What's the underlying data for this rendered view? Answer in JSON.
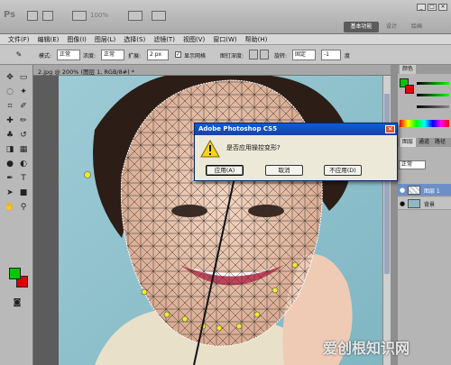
{
  "app": {
    "logo": "Ps",
    "zoom": "100%",
    "workspaces": {
      "active": "基本功能",
      "others": [
        "设计",
        "绘画"
      ]
    }
  },
  "menu": [
    "文件(F)",
    "编辑(E)",
    "图像(I)",
    "图层(L)",
    "选择(S)",
    "滤镜(T)",
    "视图(V)",
    "窗口(W)",
    "帮助(H)"
  ],
  "options": {
    "mode_label": "模式:",
    "mode_value": "正常",
    "density_label": "浓度:",
    "density_value": "正常",
    "expand_label": "扩展:",
    "expand_value": "2 px",
    "show_mesh_label": "显示网格",
    "pin_depth_label": "图钉深度:",
    "rotate_label": "旋转:",
    "rotate_value": "固定",
    "angle_value": "-1",
    "degree_label": "度"
  },
  "document": {
    "tab_label": "2.jpg @ 200% (图层 1, RGB/8#) *"
  },
  "colors": {
    "foreground": "#00c800",
    "background": "#e00000",
    "accent": "#0a5ed8"
  },
  "panels": {
    "color_tab": "颜色",
    "layers_tabs": [
      "图层",
      "通道",
      "路径"
    ],
    "blend_mode": "正常",
    "layers": [
      {
        "name": "图层 1",
        "selected": true
      },
      {
        "name": "背景",
        "selected": false
      }
    ]
  },
  "dialog": {
    "title": "Adobe Photoshop CS5",
    "message": "是否应用操控变形?",
    "apply_button": "应用(A)",
    "cancel_button": "取消",
    "dont_apply_button": "不应用(D)",
    "icon": "warning-icon"
  },
  "watermark": "爱创根知识网"
}
